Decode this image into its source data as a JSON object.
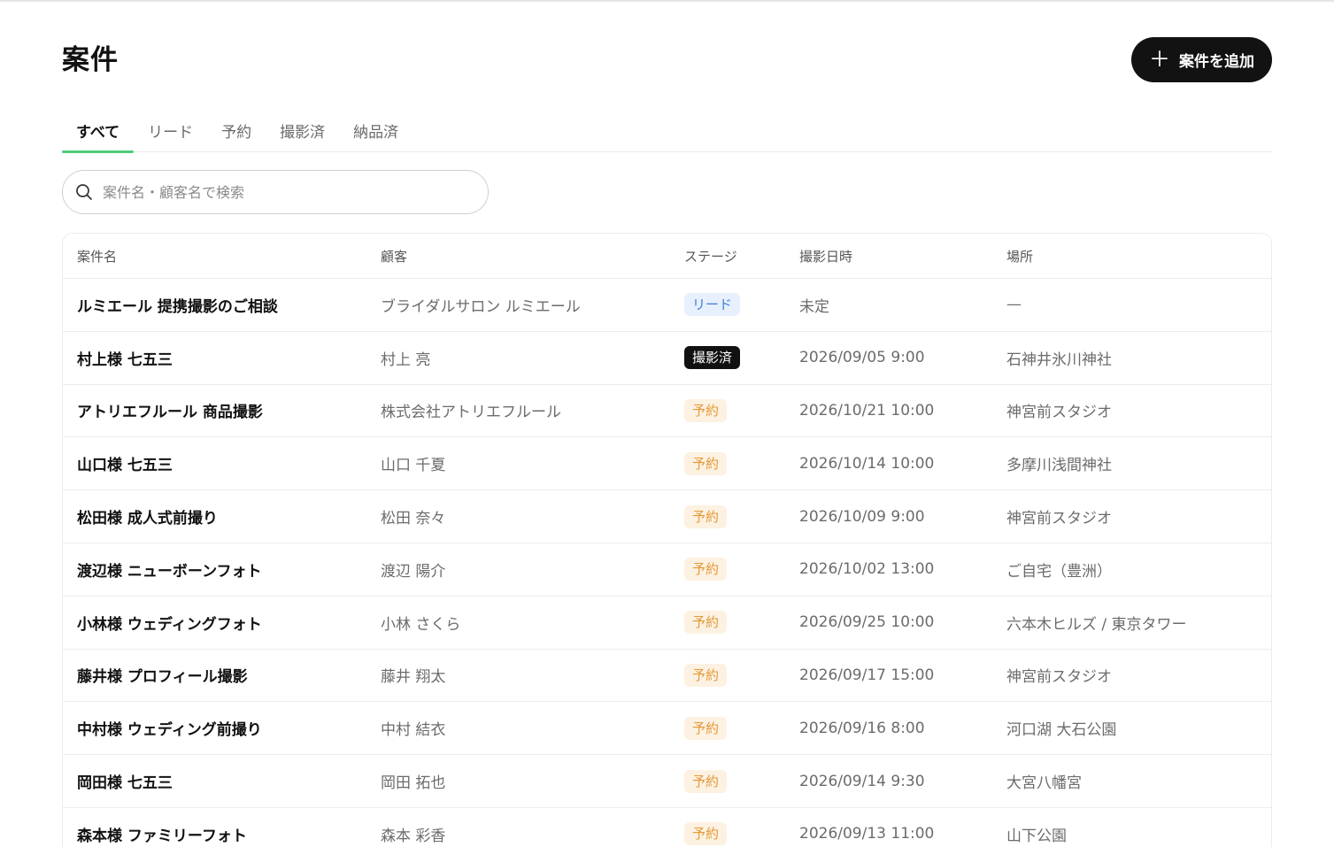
{
  "header": {
    "title": "案件",
    "add_button_label": "案件を追加",
    "add_icon": "plus-icon"
  },
  "tabs": [
    {
      "label": "すべて",
      "active": true
    },
    {
      "label": "リード",
      "active": false
    },
    {
      "label": "予約",
      "active": false
    },
    {
      "label": "撮影済",
      "active": false
    },
    {
      "label": "納品済",
      "active": false
    }
  ],
  "search": {
    "placeholder": "案件名・顧客名で検索",
    "icon": "search-icon"
  },
  "table": {
    "columns": [
      "案件名",
      "顧客",
      "ステージ",
      "撮影日時",
      "場所"
    ],
    "rows": [
      {
        "name": "ルミエール 提携撮影のご相談",
        "customer": "ブライダルサロン ルミエール",
        "stage": "リード",
        "stage_type": "lead",
        "datetime": "未定",
        "location": "—"
      },
      {
        "name": "村上様 七五三",
        "customer": "村上 亮",
        "stage": "撮影済",
        "stage_type": "shot",
        "datetime": "2026/09/05 9:00",
        "location": "石神井氷川神社"
      },
      {
        "name": "アトリエフルール 商品撮影",
        "customer": "株式会社アトリエフルール",
        "stage": "予約",
        "stage_type": "booked",
        "datetime": "2026/10/21 10:00",
        "location": "神宮前スタジオ"
      },
      {
        "name": "山口様 七五三",
        "customer": "山口 千夏",
        "stage": "予約",
        "stage_type": "booked",
        "datetime": "2026/10/14 10:00",
        "location": "多摩川浅間神社"
      },
      {
        "name": "松田様 成人式前撮り",
        "customer": "松田 奈々",
        "stage": "予約",
        "stage_type": "booked",
        "datetime": "2026/10/09 9:00",
        "location": "神宮前スタジオ"
      },
      {
        "name": "渡辺様 ニューボーンフォト",
        "customer": "渡辺 陽介",
        "stage": "予約",
        "stage_type": "booked",
        "datetime": "2026/10/02 13:00",
        "location": "ご自宅（豊洲）"
      },
      {
        "name": "小林様 ウェディングフォト",
        "customer": "小林 さくら",
        "stage": "予約",
        "stage_type": "booked",
        "datetime": "2026/09/25 10:00",
        "location": "六本木ヒルズ / 東京タワー"
      },
      {
        "name": "藤井様 プロフィール撮影",
        "customer": "藤井 翔太",
        "stage": "予約",
        "stage_type": "booked",
        "datetime": "2026/09/17 15:00",
        "location": "神宮前スタジオ"
      },
      {
        "name": "中村様 ウェディング前撮り",
        "customer": "中村 結衣",
        "stage": "予約",
        "stage_type": "booked",
        "datetime": "2026/09/16 8:00",
        "location": "河口湖 大石公園"
      },
      {
        "name": "岡田様 七五三",
        "customer": "岡田 拓也",
        "stage": "予約",
        "stage_type": "booked",
        "datetime": "2026/09/14 9:30",
        "location": "大宮八幡宮"
      },
      {
        "name": "森本様 ファミリーフォト",
        "customer": "森本 彩香",
        "stage": "予約",
        "stage_type": "booked",
        "datetime": "2026/09/13 11:00",
        "location": "山下公園"
      }
    ]
  },
  "colors": {
    "accent": "#4ccb7a",
    "primary_button": "#121212",
    "lead_badge": "#3e7be0",
    "booked_badge": "#e49a3a"
  }
}
